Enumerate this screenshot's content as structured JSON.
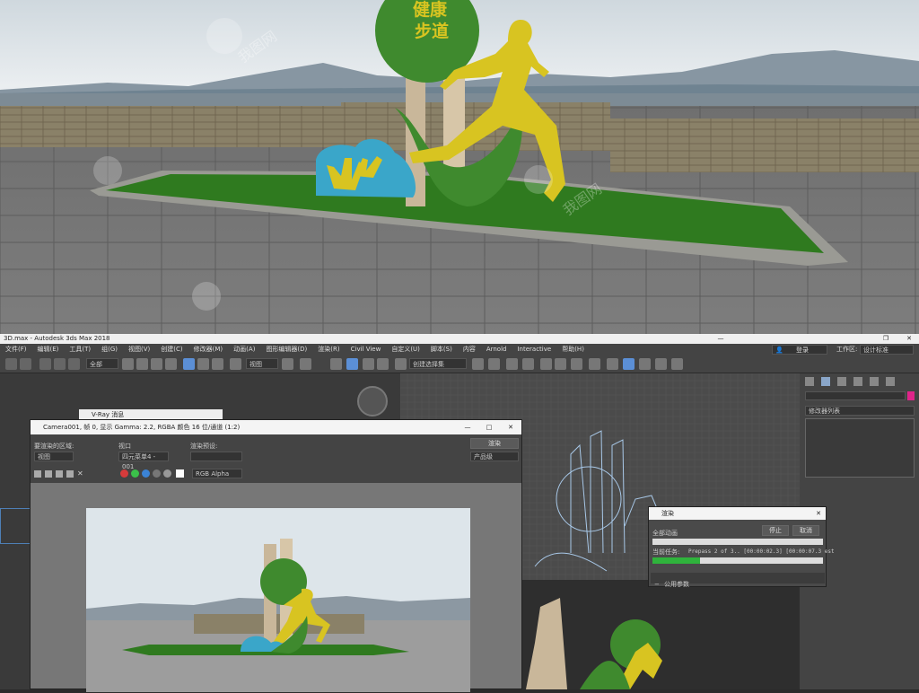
{
  "hero": {
    "sign_line1": "健康",
    "sign_line2": "步道",
    "watermark": "我图网"
  },
  "window": {
    "title": "3D.max - Autodesk 3ds Max 2018",
    "controls": [
      "—",
      "❐",
      "✕"
    ]
  },
  "menu": [
    "文件(F)",
    "编辑(E)",
    "工具(T)",
    "组(G)",
    "视图(V)",
    "创建(C)",
    "修改器(M)",
    "动画(A)",
    "图形编辑器(D)",
    "渲染(R)",
    "Civil View",
    "自定义(U)",
    "脚本(S)",
    "内容",
    "Arnold",
    "Interactive",
    "帮助(H)"
  ],
  "menu_right": {
    "login": "登录",
    "workspace_label": "工作区:",
    "workspace_value": "设计标准"
  },
  "toolbar": {
    "selection_filter": "全部",
    "view_dropdown": "视图",
    "selection_set": "创建选择集"
  },
  "vray_window": {
    "tab": "V-Ray 消息"
  },
  "frame_buffer": {
    "title": "Camera001, 帧 0, 显示 Gamma: 2.2, RGBA 颜色 16 位/通道 (1:2)",
    "area_label": "要渲染的区域:",
    "area_value": "视图",
    "viewport_label": "视口",
    "viewport_value": "四元菜单4 - 001",
    "preset_label": "渲染预设:",
    "preset_value": "",
    "render_button": "渲染",
    "product_dropdown": "产品级",
    "channel_dropdown": "RGB Alpha"
  },
  "render_dialog": {
    "title": "渲染",
    "all_animation": "全部动画",
    "stop": "停止",
    "cancel": "取消",
    "current_task_label": "当前任务:",
    "current_task": "Prepass 2 of 3.. [00:00:02.3] [00:00:07.3 est",
    "progress": 0.28,
    "section": "公用参数"
  },
  "command_panel": {
    "modifier_list": "修改器列表"
  },
  "colors": {
    "green": "#3f8a2e",
    "yellow": "#d8c421",
    "teal": "#3aa6c9",
    "grass": "#2f7a1f"
  }
}
